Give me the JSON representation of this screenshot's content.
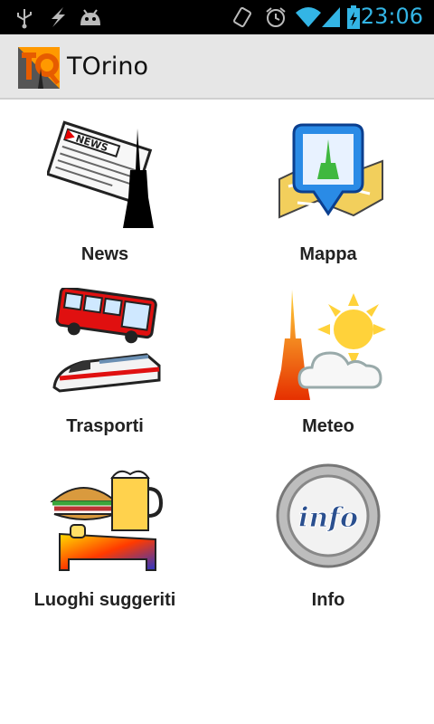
{
  "status_bar": {
    "time": "23:06",
    "icons": [
      "usb-icon",
      "debug-lightning-icon",
      "android-icon",
      "rotation-icon",
      "alarm-icon",
      "wifi-icon",
      "signal-icon",
      "battery-charging-icon"
    ]
  },
  "action_bar": {
    "app_icon": "torino-logo-icon",
    "title": "TOrino"
  },
  "menu": {
    "items": [
      {
        "label": "News",
        "icon": "newspaper-icon"
      },
      {
        "label": "Mappa",
        "icon": "map-pin-icon"
      },
      {
        "label": "Trasporti",
        "icon": "bus-train-icon"
      },
      {
        "label": "Meteo",
        "icon": "weather-icon"
      },
      {
        "label": "Luoghi suggeriti",
        "icon": "food-bed-icon"
      },
      {
        "label": "Info",
        "icon": "info-icon"
      }
    ]
  },
  "colors": {
    "status_bar_bg": "#000000",
    "clock": "#33b5e5",
    "action_bar_bg": "#e6e6e6"
  }
}
